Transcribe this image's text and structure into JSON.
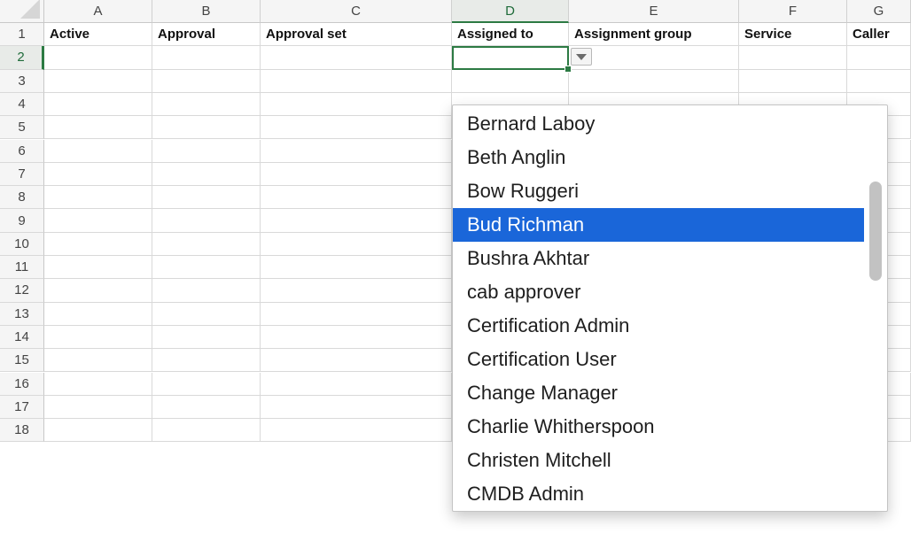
{
  "spreadsheet": {
    "columns": [
      "A",
      "B",
      "C",
      "D",
      "E",
      "F",
      "G"
    ],
    "selected_column": "D",
    "rows": [
      "1",
      "2",
      "3",
      "4",
      "5",
      "6",
      "7",
      "8",
      "9",
      "10",
      "11",
      "12",
      "13",
      "14",
      "15",
      "16",
      "17",
      "18"
    ],
    "selected_row": "2",
    "header_cells": [
      "Active",
      "Approval",
      "Approval set",
      "Assigned to",
      "Assignment group",
      "Service",
      "Caller"
    ]
  },
  "dropdown": {
    "items": [
      "Bernard Laboy",
      "Beth Anglin",
      "Bow Ruggeri",
      "Bud Richman",
      "Bushra Akhtar",
      "cab approver",
      "Certification Admin",
      "Certification User",
      "Change Manager",
      "Charlie Whitherspoon",
      "Christen Mitchell",
      "CMDB Admin"
    ],
    "highlighted": "Bud Richman"
  },
  "colors": {
    "selection_green": "#2c7a43",
    "highlight_blue": "#1a66d9",
    "header_bg": "#f5f5f5",
    "grid_line": "#d9d9d9"
  },
  "icons": {
    "dropdown_button": "chevron-down-icon",
    "select_all": "select-all-triangle-icon"
  }
}
